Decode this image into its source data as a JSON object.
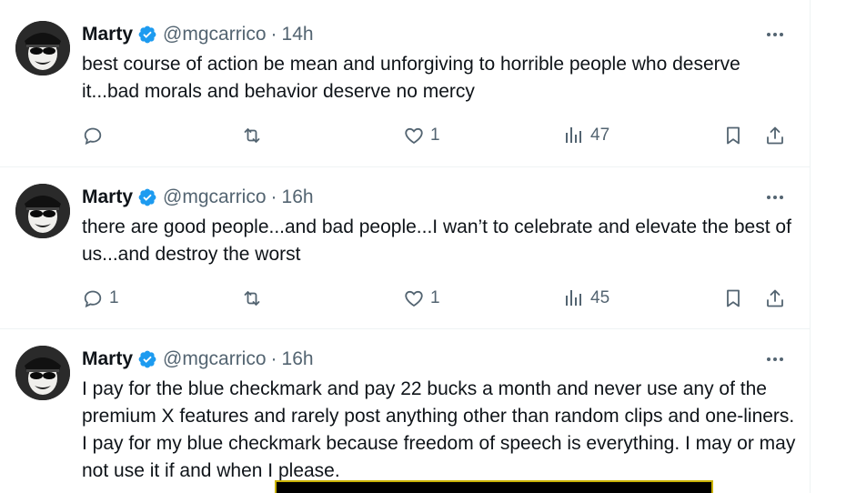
{
  "colors": {
    "accent": "#1d9bf0",
    "muted": "#536471",
    "text": "#0f1419",
    "divider": "#eff3f4"
  },
  "tweets": [
    {
      "name": "Marty",
      "handle": "@mgcarrico",
      "separator": "·",
      "time": "14h",
      "text": "best course of action be mean and unforgiving to horrible people who deserve it...bad morals and behavior deserve no mercy",
      "replies": "",
      "reposts": "",
      "likes": "1",
      "views": "47"
    },
    {
      "name": "Marty",
      "handle": "@mgcarrico",
      "separator": "·",
      "time": "16h",
      "text": "there are good people...and bad people...I wan’t to celebrate and elevate the best of us...and destroy the worst",
      "replies": "1",
      "reposts": "",
      "likes": "1",
      "views": "45"
    },
    {
      "name": "Marty",
      "handle": "@mgcarrico",
      "separator": "·",
      "time": "16h",
      "text": "I pay for the blue checkmark and pay 22 bucks a month and never use any of the premium X features and rarely post anything other than random clips and one-liners.  I pay for my blue checkmark because freedom of speech is everything.  I may or may not use it if and when I please."
    }
  ],
  "icons": {
    "reply": "reply-icon",
    "repost": "repost-icon",
    "like": "heart-icon",
    "views": "views-icon",
    "bookmark": "bookmark-icon",
    "share": "share-icon",
    "more": "more-icon",
    "verified": "verified-badge-icon"
  }
}
